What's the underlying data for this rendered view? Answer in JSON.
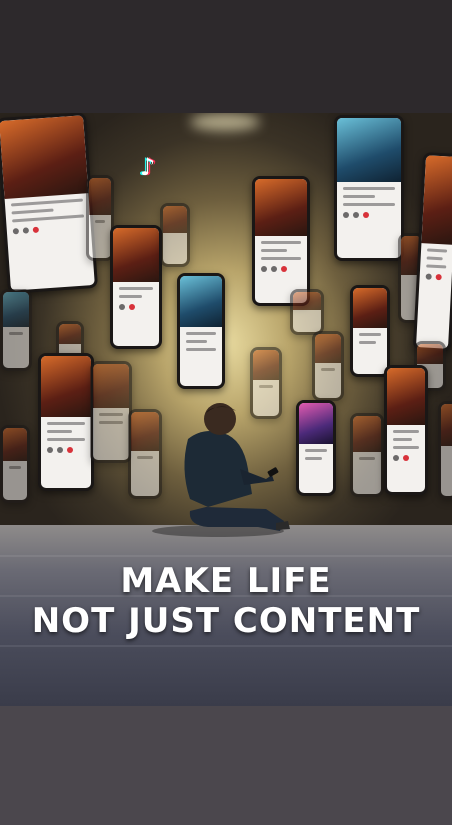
{
  "poster": {
    "headline_line1": "MAKE LIFE",
    "headline_line2": "NOT JUST CONTENT",
    "icons": [
      "tiktok-logo-icon"
    ],
    "colors": {
      "top_bar": "#2d292c",
      "bottom_bar": "#4b474d",
      "text": "#ffffff",
      "accent_red": "#d8323a"
    }
  }
}
